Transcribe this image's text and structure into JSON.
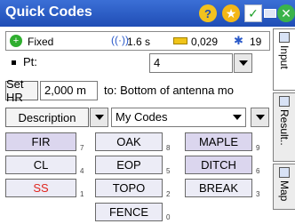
{
  "window": {
    "title": "Quick Codes"
  },
  "toolbar": {
    "help_icon": "?",
    "star_icon": "★",
    "check_icon": "✓",
    "close_icon": "✕"
  },
  "status": {
    "solution": "Fixed",
    "latency": "1.6 s",
    "precision": "0,029",
    "satellites": "19"
  },
  "side_tabs": [
    {
      "label": "Input"
    },
    {
      "label": "Result.."
    },
    {
      "label": "Map"
    }
  ],
  "point": {
    "label": "Pt:",
    "value": "4"
  },
  "height": {
    "button_label": "Set HR",
    "value": "2,000 m",
    "target_text": "to: Bottom of antenna mo"
  },
  "description": {
    "button_label": "Description",
    "library": "My Codes"
  },
  "codes": [
    {
      "label": "FIR",
      "key": "7"
    },
    {
      "label": "OAK",
      "key": "8"
    },
    {
      "label": "MAPLE",
      "key": "9"
    },
    {
      "label": "CL",
      "key": "4"
    },
    {
      "label": "EOP",
      "key": "5"
    },
    {
      "label": "DITCH",
      "key": "6"
    },
    {
      "label": "SS",
      "key": "1"
    },
    {
      "label": "TOPO",
      "key": "2"
    },
    {
      "label": "BREAK",
      "key": "3"
    },
    {
      "label": "FENCE",
      "key": "0"
    }
  ],
  "colors": {
    "titlebar": "#2b5ac8",
    "fix_status": "#2fae2f",
    "selected_code_text": "#e0261f"
  }
}
